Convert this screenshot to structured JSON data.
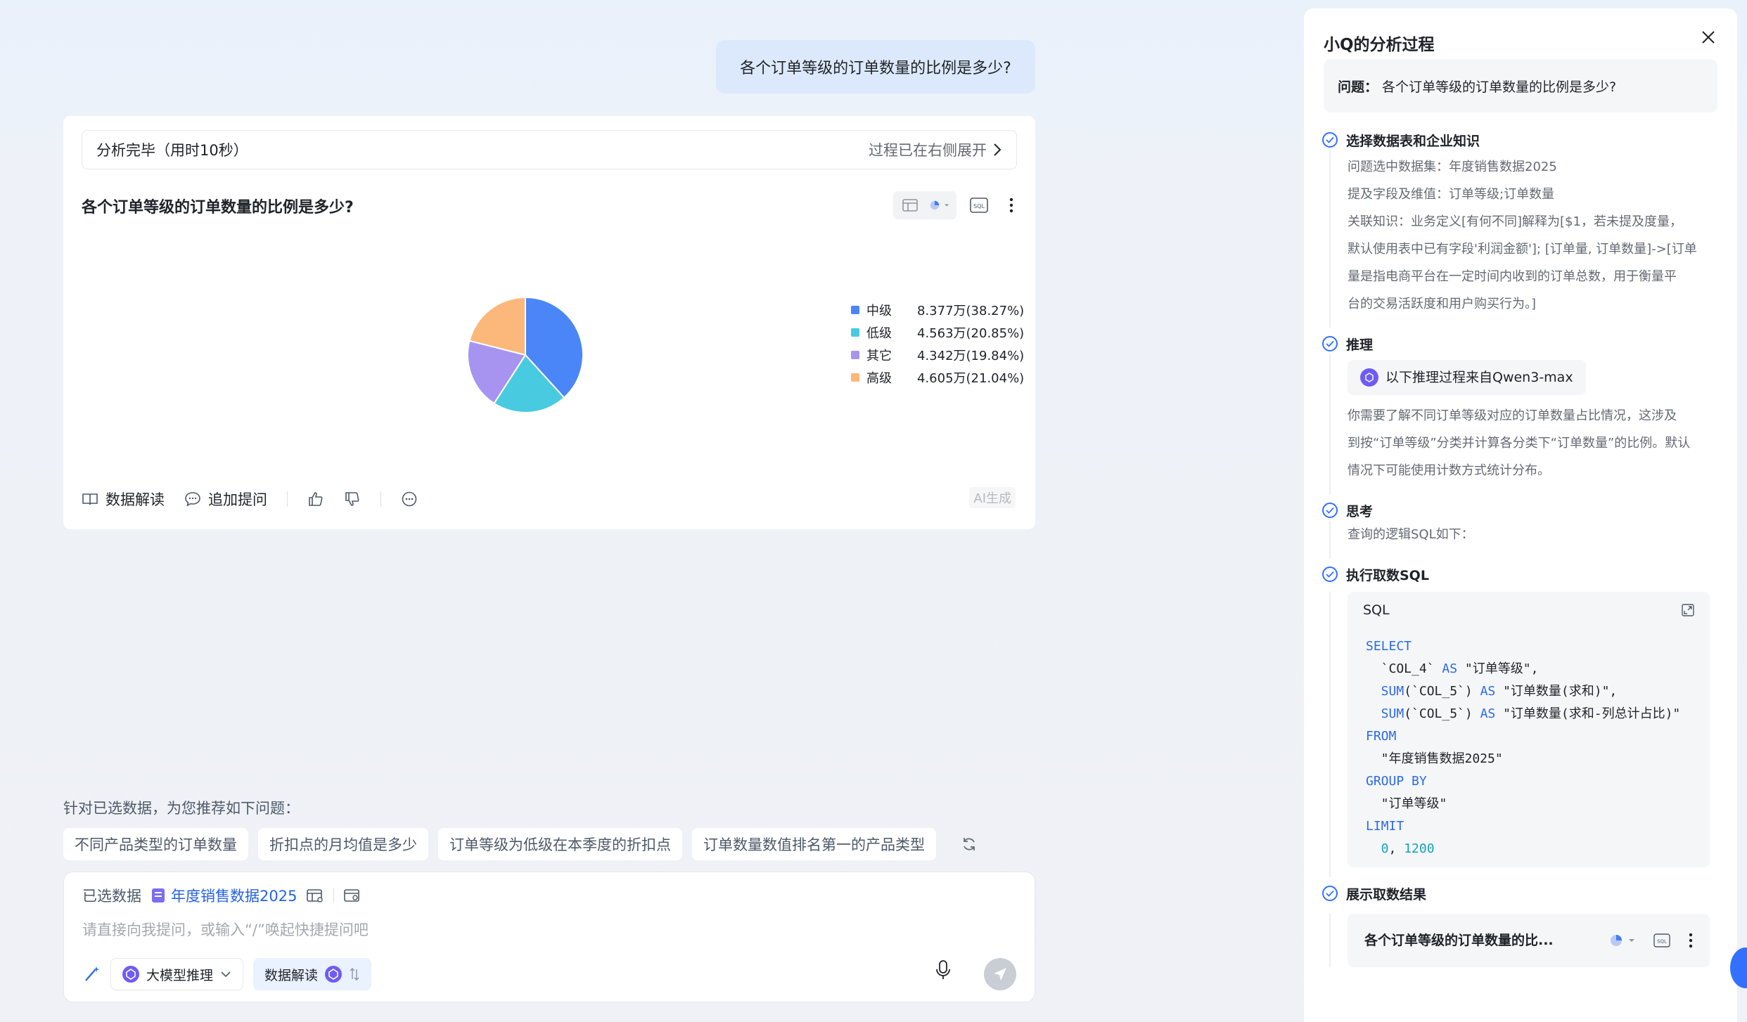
{
  "user_message": "各个订单等级的订单数量的比例是多少?",
  "answer": {
    "status_left": "分析完毕（用时10秒）",
    "status_right": "过程已在右侧展开",
    "chart_title": "各个订单等级的订单数量的比例是多少?",
    "actions": {
      "data_interpret": "数据解读",
      "follow_up": "追加提问"
    },
    "ai_tag": "AI生成"
  },
  "chart_data": {
    "type": "pie",
    "categories": [
      "中级",
      "低级",
      "其它",
      "高级"
    ],
    "values": [
      38.27,
      20.85,
      19.84,
      21.04
    ],
    "value_labels": [
      "8.377万(38.27%)",
      "4.563万(20.85%)",
      "4.342万(19.84%)",
      "4.605万(21.04%)"
    ],
    "colors": [
      "#4a86f7",
      "#48cbe0",
      "#a794f0",
      "#fbb87a"
    ],
    "legend": "right"
  },
  "recommend": {
    "label": "针对已选数据，为您推荐如下问题：",
    "chips": [
      "不同产品类型的订单数量",
      "折扣点的月均值是多少",
      "订单等级为低级在本季度的折扣点",
      "订单数量数值排名第一的产品类型"
    ]
  },
  "input": {
    "selected_label": "已选数据",
    "dataset": "年度销售数据2025",
    "placeholder": "请直接向我提问，或输入“/”唤起快捷提问吧",
    "model_pill": "大模型推理",
    "interpret_pill": "数据解读"
  },
  "panel": {
    "title": "小Q的分析过程",
    "question_prefix": "问题：",
    "question": "各个订单等级的订单数量的比例是多少?",
    "steps": {
      "s1": {
        "title": "选择数据表和企业知识",
        "lines": [
          "问题选中数据集：年度销售数据2025",
          "提及字段及维值：订单等级;订单数量",
          "关联知识：业务定义[有何不同]解释为[$1，若未提及度量，",
          "默认使用表中已有字段'利润金额']; [订单量, 订单数量]->[订单",
          "量是指电商平台在一定时间内收到的订单总数，用于衡量平",
          "台的交易活跃度和用户购买行为。]"
        ]
      },
      "s2": {
        "title": "推理",
        "model_note": "以下推理过程来自Qwen3-max",
        "lines": [
          "你需要了解不同订单等级对应的订单数量占比情况，这涉及",
          "到按“订单等级”分类并计算各分类下“订单数量”的比例。默认",
          "情况下可能使用计数方式统计分布。"
        ]
      },
      "s3": {
        "title": "思考",
        "text": "查询的逻辑SQL如下："
      },
      "s4": {
        "title": "执行取数SQL",
        "sql_label": "SQL",
        "sql": {
          "l1": "SELECT",
          "l2a": "  `COL_4` ",
          "l2b": "AS",
          "l2c": " \"订单等级\",",
          "l3a": "  SUM",
          "l3b": "(`COL_5`) ",
          "l3c": "AS",
          "l3d": " \"订单数量(求和)\",",
          "l4a": "  SUM",
          "l4b": "(`COL_5`) ",
          "l4c": "AS",
          "l4d": " \"订单数量(求和-列总计占比)\"",
          "l5": "FROM",
          "l6": "  \"年度销售数据2025\"",
          "l7": "GROUP BY",
          "l8": "  \"订单等级\"",
          "l9": "LIMIT",
          "l10a": "  0",
          "l10b": ", ",
          "l10c": "1200"
        }
      },
      "s5": {
        "title": "展示取数结果",
        "card_title": "各个订单等级的订单数量的比..."
      }
    }
  }
}
